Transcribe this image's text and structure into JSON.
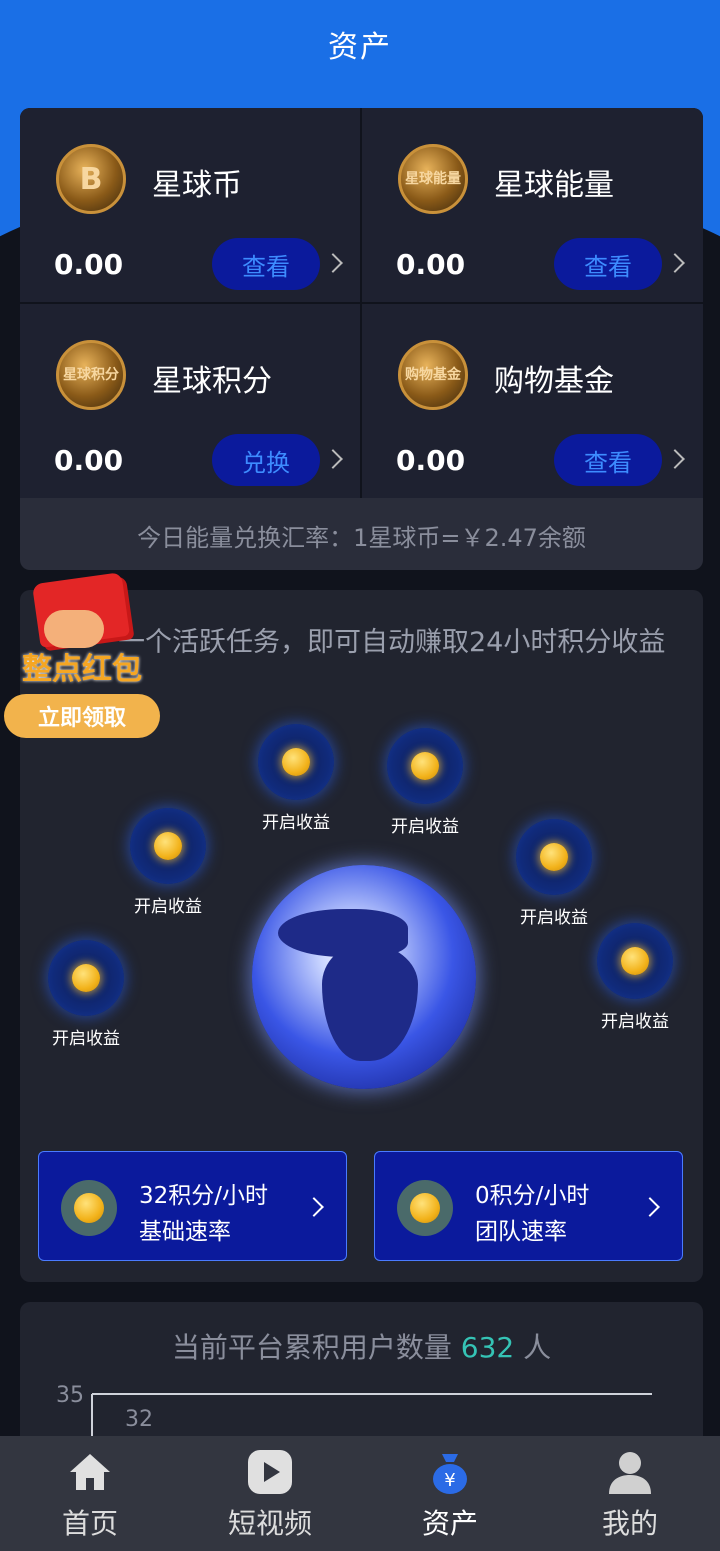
{
  "header": {
    "title": "资产"
  },
  "assets": [
    {
      "name": "星球币",
      "value": "0.00",
      "action": "查看",
      "icon": "bitcoin-coin-icon",
      "coin_text": "B"
    },
    {
      "name": "星球能量",
      "value": "0.00",
      "action": "查看",
      "icon": "energy-coin-icon",
      "coin_text": "星球能量"
    },
    {
      "name": "星球积分",
      "value": "0.00",
      "action": "兑换",
      "icon": "points-coin-icon",
      "coin_text": "星球积分"
    },
    {
      "name": "购物基金",
      "value": "0.00",
      "action": "查看",
      "icon": "fund-coin-icon",
      "coin_text": "购物基金"
    }
  ],
  "rate_text": "今日能量兑换汇率：1星球币=￥2.47余额",
  "tasks": {
    "text": "一个活跃任务，即可自动赚取24小时积分收益",
    "bubbles": [
      {
        "label": "开启收益"
      },
      {
        "label": "开启收益"
      },
      {
        "label": "开启收益"
      },
      {
        "label": "开启收益"
      },
      {
        "label": "开启收益"
      },
      {
        "label": "开启收益"
      }
    ],
    "speeds": [
      {
        "line1": "32积分/小时",
        "line2": "基础速率"
      },
      {
        "line1": "0积分/小时",
        "line2": "团队速率"
      }
    ]
  },
  "red_packet": {
    "title": "整点红包",
    "button": "立即领取"
  },
  "users": {
    "title_prefix": "当前平台累积用户数量",
    "count": "632",
    "unit": "人"
  },
  "chart_data": {
    "type": "line",
    "y_tick_top": "35",
    "values": [
      32
    ],
    "labels": [
      "32"
    ]
  },
  "nav": [
    {
      "label": "首页",
      "icon": "home-icon"
    },
    {
      "label": "短视频",
      "icon": "video-play-icon"
    },
    {
      "label": "资产",
      "icon": "money-bag-icon",
      "active": true
    },
    {
      "label": "我的",
      "icon": "user-profile-icon"
    }
  ]
}
